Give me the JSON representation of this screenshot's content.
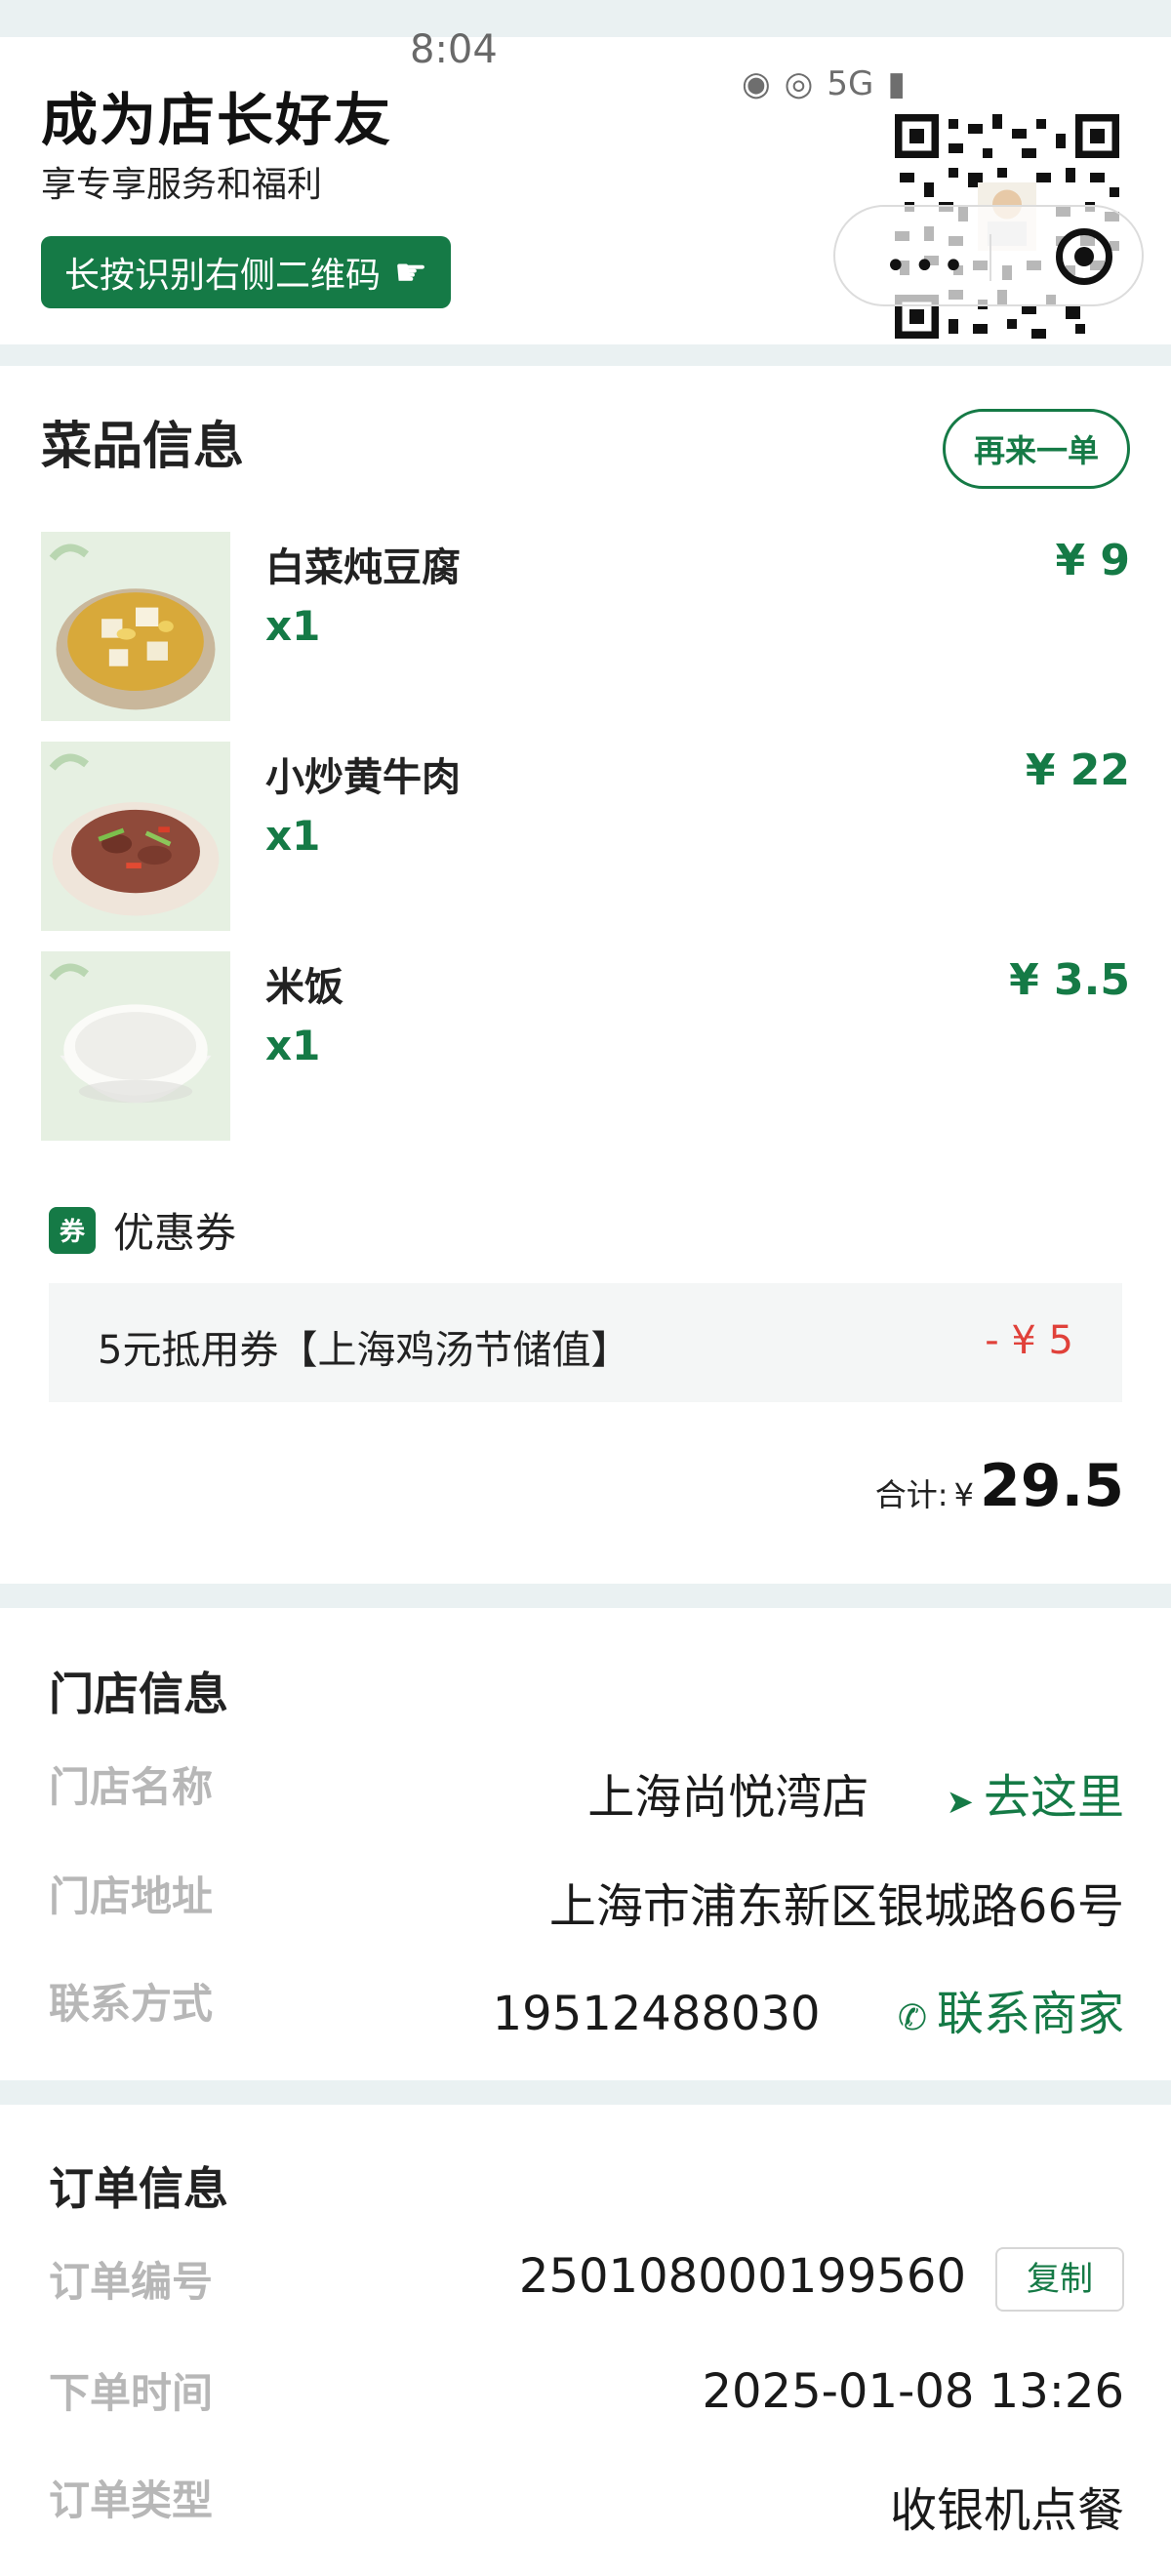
{
  "status_bar": {
    "time": "8:04",
    "network": "5G"
  },
  "banner": {
    "title": "成为店长好友",
    "subtitle": "享专享服务和福利",
    "button_label": "长按识别右侧二维码"
  },
  "dishes": {
    "title": "菜品信息",
    "reorder_label": "再来一单",
    "items": [
      {
        "name": "白菜炖豆腐",
        "qty": "x1",
        "price": "¥ 9"
      },
      {
        "name": "小炒黄牛肉",
        "qty": "x1",
        "price": "¥ 22"
      },
      {
        "name": "米饭",
        "qty": "x1",
        "price": "¥ 3.5"
      }
    ],
    "coupon": {
      "badge": "券",
      "label": "优惠券",
      "name": "5元抵用券【上海鸡汤节储值】",
      "amount": "- ¥ 5"
    },
    "total": {
      "label": "合计:",
      "currency": "¥",
      "value": "29.5"
    }
  },
  "store": {
    "title": "门店信息",
    "name_key": "门店名称",
    "name_value": "上海尚悦湾店",
    "navigate_label": "去这里",
    "address_key": "门店地址",
    "address_value": "上海市浦东新区银城路66号",
    "contact_key": "联系方式",
    "contact_value": "19512488030",
    "contact_label": "联系商家"
  },
  "order": {
    "title": "订单信息",
    "number_key": "订单编号",
    "number_value": "250108000199560",
    "copy_label": "复制",
    "time_key": "下单时间",
    "time_value": "2025-01-08 13:26",
    "type_key": "订单类型",
    "type_value": "收银机点餐"
  },
  "colors": {
    "brand_green": "#157a46",
    "discount_red": "#e0413a",
    "page_bg": "#eaf1f2"
  }
}
